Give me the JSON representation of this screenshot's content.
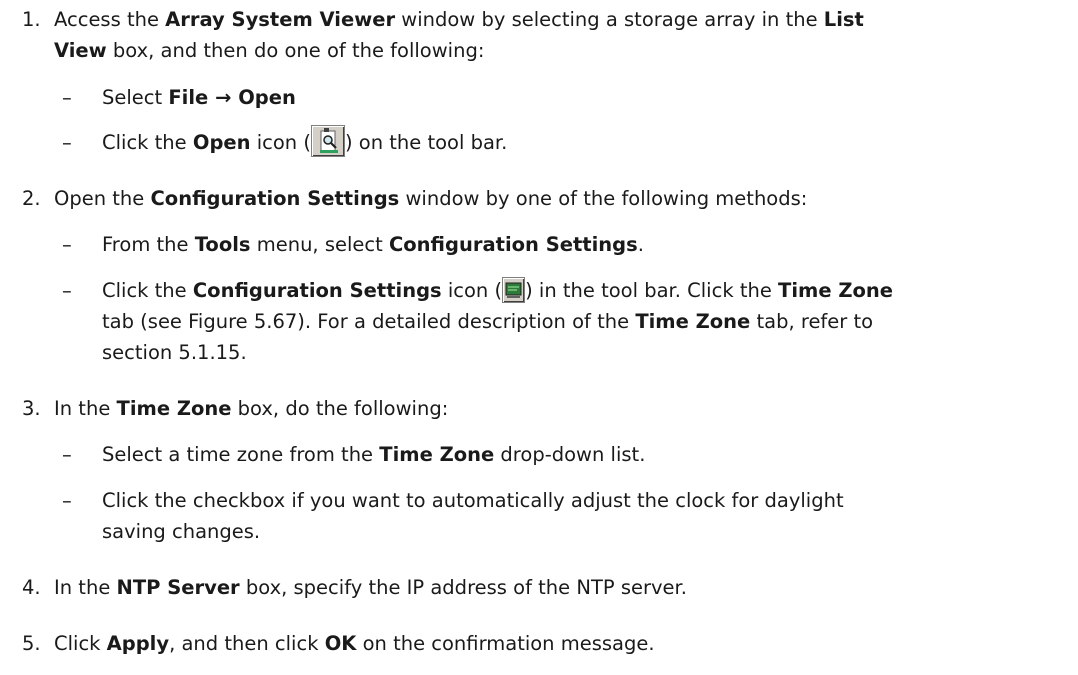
{
  "steps": [
    {
      "num": "1.",
      "line1": {
        "t1": "Access the ",
        "b1": "Array System Viewer",
        "t2": " window by selecting a storage array in the ",
        "b2": "List"
      },
      "line2": {
        "b1": "View",
        "t1": " box, and then do one of the following:"
      },
      "subs": [
        {
          "dash": "–",
          "t1": "Select ",
          "b1": "File → Open"
        },
        {
          "dash": "–",
          "t1": "Click the ",
          "b1": "Open",
          "t2": " icon (",
          "icon": "open-search-icon",
          "t3": ") on the tool bar."
        }
      ]
    },
    {
      "num": "2.",
      "line1": {
        "t1": "Open the ",
        "b1": "Configuration Settings",
        "t2": " window by one of the following methods:"
      },
      "subs": [
        {
          "dash": "–",
          "t1": "From the ",
          "b1": "Tools",
          "t2": " menu, select ",
          "b2": "Configuration Settings",
          "t3": "."
        },
        {
          "dash": "–",
          "line1": {
            "t1": "Click the ",
            "b1": "Configuration Settings",
            "t2": " icon (",
            "icon": "monitor-config-icon",
            "t3": ") in the tool bar. Click the ",
            "b2": "Time Zone"
          },
          "line2": {
            "t1": "tab (see Figure 5.67). For a detailed description of the ",
            "b1": "Time Zone",
            "t2": " tab, refer to"
          },
          "line3": {
            "t1": "section 5.1.15."
          }
        }
      ]
    },
    {
      "num": "3.",
      "line1": {
        "t1": "In the ",
        "b1": "Time Zone",
        "t2": " box, do the following:"
      },
      "subs": [
        {
          "dash": "–",
          "t1": "Select a time zone from the ",
          "b1": "Time Zone",
          "t2": " drop-down list."
        },
        {
          "dash": "–",
          "line1": {
            "t1": "Click the checkbox if you want to automatically adjust the clock for daylight"
          },
          "line2": {
            "t1": "saving changes."
          }
        }
      ]
    },
    {
      "num": "4.",
      "line1": {
        "t1": "In the ",
        "b1": "NTP Server",
        "t2": " box, specify the IP address of the NTP server."
      }
    },
    {
      "num": "5.",
      "line1": {
        "t1": "Click ",
        "b1": "Apply",
        "t2": ", and then click ",
        "b2": "OK",
        "t3": " on the confirmation message."
      }
    }
  ]
}
